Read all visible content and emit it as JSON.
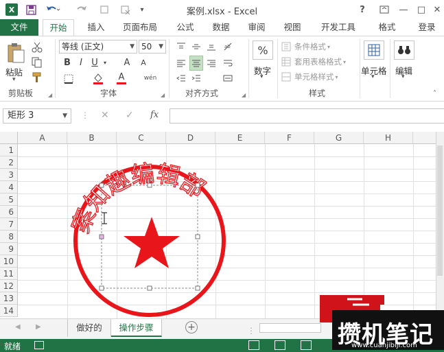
{
  "titlebar": {
    "title": "案例.xlsx - Excel",
    "help": "?",
    "minimize": "—",
    "restore": "□",
    "close": "✕"
  },
  "tabs": [
    "文件",
    "开始",
    "插入",
    "页面布局",
    "公式",
    "数据",
    "审阅",
    "视图",
    "开发工具",
    "格式"
  ],
  "login": "登录",
  "ribbon": {
    "clipboard": {
      "paste": "粘贴",
      "label": "剪贴板"
    },
    "font": {
      "name": "等线 (正文)",
      "size": "50",
      "label": "字体",
      "bold": "B",
      "italic": "I",
      "underline": "U",
      "grow": "A",
      "shrink": "A",
      "fontcolor": "A",
      "wen": "wén"
    },
    "align": {
      "label": "对齐方式"
    },
    "number": {
      "pct": "%",
      "label": "数字"
    },
    "styles": {
      "conditional": "条件格式",
      "table": "套用表格格式",
      "cell": "单元格样式",
      "label": "样式"
    },
    "cells": {
      "label": "单元格"
    },
    "edit": {
      "label": "编辑"
    }
  },
  "formula": {
    "namebox": "矩形 3",
    "fx": "fx"
  },
  "columns": [
    "A",
    "B",
    "C",
    "D",
    "E",
    "F",
    "G",
    "H"
  ],
  "rows": [
    "1",
    "2",
    "3",
    "4",
    "5",
    "6",
    "7",
    "8",
    "9",
    "10",
    "11",
    "12",
    "13",
    "14"
  ],
  "stamp": {
    "text": "案知趣编辑部",
    "color": "#e8151b"
  },
  "sheets": [
    "做好的",
    "操作步骤"
  ],
  "status": {
    "ready": "就绪"
  },
  "watermark": {
    "brand": "攒机笔记",
    "url": "www.cuanjibiji.com"
  }
}
